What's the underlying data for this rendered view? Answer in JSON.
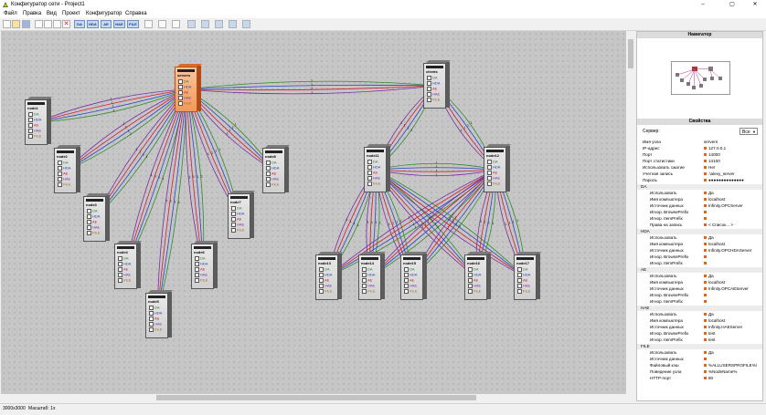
{
  "window": {
    "title": "Конфигуратор сети - Project1",
    "buttons": {
      "minimize": "–",
      "maximize": "▢",
      "close": "✕"
    }
  },
  "menu": [
    "Файл",
    "Правка",
    "Вид",
    "Проект",
    "Конфигуратор",
    "Справка"
  ],
  "toolbar": {
    "file_buttons": [
      "new-icon",
      "open-icon",
      "save-icon",
      "cut-icon",
      "copy-icon",
      "paste-icon",
      "delete-icon"
    ],
    "server_types": [
      "DA",
      "HDA",
      "AE",
      "HAE",
      "FILE"
    ],
    "view_buttons": [
      "window-icon",
      "layers-icon",
      "connect-icon",
      "align-left-icon",
      "align-top-icon",
      "arrange-icon",
      "tree-icon"
    ]
  },
  "nodes": [
    {
      "name": "servers",
      "selected": true,
      "items": [
        "DA",
        "HDA",
        "AE",
        "HAE",
        "FILE"
      ]
    },
    {
      "name": "clients",
      "selected": false,
      "items": [
        "DA",
        "HDA",
        "AE",
        "HAE",
        "FILE"
      ]
    },
    {
      "name": "node1",
      "selected": false,
      "items": [
        "DA",
        "HDA",
        "AE",
        "HAE",
        "FILE"
      ]
    },
    {
      "name": "node2",
      "selected": false,
      "items": [
        "DA",
        "HDA",
        "AE",
        "HAE",
        "FILE"
      ]
    },
    {
      "name": "node3",
      "selected": false,
      "items": [
        "DA",
        "HDA",
        "AE",
        "HAE",
        "FILE"
      ]
    },
    {
      "name": "node4",
      "selected": false,
      "items": [
        "DA",
        "HDA",
        "AE",
        "HAE",
        "FILE"
      ]
    },
    {
      "name": "node5",
      "selected": false,
      "items": [
        "DA",
        "HDA",
        "AE",
        "HAE",
        "FILE"
      ]
    },
    {
      "name": "node6",
      "selected": false,
      "items": [
        "DA",
        "HDA",
        "AE",
        "HAE",
        "FILE"
      ]
    },
    {
      "name": "node7",
      "selected": false,
      "items": [
        "DA",
        "HDA",
        "AE",
        "HAE",
        "FILE"
      ]
    },
    {
      "name": "node8",
      "selected": false,
      "items": [
        "DA",
        "HDA",
        "AE",
        "HAE",
        "FILE"
      ]
    },
    {
      "name": "node11",
      "selected": false,
      "items": [
        "DA",
        "HDA",
        "AE",
        "HAE",
        "FILE"
      ]
    },
    {
      "name": "node12",
      "selected": false,
      "items": [
        "DA",
        "HDA",
        "AE",
        "HAE",
        "FILE"
      ]
    },
    {
      "name": "node13",
      "selected": false,
      "items": [
        "DA",
        "HDA",
        "AE",
        "HAE",
        "FILE"
      ]
    },
    {
      "name": "node14",
      "selected": false,
      "items": [
        "DA",
        "HDA",
        "AE",
        "HAE",
        "FILE"
      ]
    },
    {
      "name": "node15",
      "selected": false,
      "items": [
        "DA",
        "HDA",
        "AE",
        "HAE",
        "FILE"
      ]
    },
    {
      "name": "node16",
      "selected": false,
      "items": [
        "DA",
        "HDA",
        "AE",
        "HAE",
        "FILE"
      ]
    },
    {
      "name": "node17",
      "selected": false,
      "items": [
        "DA",
        "HDA",
        "AE",
        "HAE",
        "FILE"
      ]
    }
  ],
  "connection_label": "1",
  "connection_colors": [
    "#2e8b2e",
    "#2a44c9",
    "#d01c2c",
    "#7a2aa8"
  ],
  "status": {
    "size": "3000x3000",
    "scale": "Масштаб: 1x"
  },
  "navigator": {
    "title": "Навигатор"
  },
  "properties": {
    "title": "Свойства",
    "server_label": "Сервер:",
    "server_filter": "Все",
    "rows": [
      {
        "key": "Имя узла",
        "value": "servers",
        "level": 1,
        "marker": false
      },
      {
        "key": "IP-адрес",
        "value": "127.0.0.1",
        "level": 1,
        "marker": true
      },
      {
        "key": "Порт",
        "value": "14000",
        "level": 1,
        "marker": true
      },
      {
        "key": "Порт статистики",
        "value": "14100",
        "level": 1,
        "marker": true
      },
      {
        "key": "Использовать сжатие",
        "value": "Нет",
        "level": 1,
        "marker": true
      },
      {
        "key": "Учетная запись",
        "value": ".\\alexy_server",
        "level": 1,
        "marker": true
      },
      {
        "key": "Пароль",
        "value": "●●●●●●●●●●●●●●",
        "level": 1,
        "marker": true
      },
      {
        "key": "DA",
        "value": "",
        "level": 0,
        "marker": false
      },
      {
        "key": "Использовать",
        "value": "Да",
        "level": 2,
        "marker": true
      },
      {
        "key": "Имя компьютера",
        "value": "localhost",
        "level": 2,
        "marker": true
      },
      {
        "key": "Источник данных",
        "value": "Infinity.OPCServer",
        "level": 2,
        "marker": true
      },
      {
        "key": "Игнор. BrowsePrefix",
        "value": "",
        "level": 2,
        "marker": true
      },
      {
        "key": "Игнор. ItemPrefix",
        "value": "",
        "level": 2,
        "marker": true
      },
      {
        "key": "Права на запись",
        "value": "< Список... >",
        "level": 2,
        "marker": true
      },
      {
        "key": "HDA",
        "value": "",
        "level": 0,
        "marker": false
      },
      {
        "key": "Использовать",
        "value": "Да",
        "level": 2,
        "marker": true
      },
      {
        "key": "Имя компьютера",
        "value": "localhost",
        "level": 2,
        "marker": true
      },
      {
        "key": "Источник данных",
        "value": "Infinity.OPCHDAServer",
        "level": 2,
        "marker": true
      },
      {
        "key": "Игнор. BrowsePrefix",
        "value": "",
        "level": 2,
        "marker": true
      },
      {
        "key": "Игнор. ItemPrefix",
        "value": "",
        "level": 2,
        "marker": true
      },
      {
        "key": "AE",
        "value": "",
        "level": 0,
        "marker": false
      },
      {
        "key": "Использовать",
        "value": "Да",
        "level": 2,
        "marker": true
      },
      {
        "key": "Имя компьютера",
        "value": "localhost",
        "level": 2,
        "marker": true
      },
      {
        "key": "Источник данных",
        "value": "Infinity.OPCAEServer",
        "level": 2,
        "marker": true
      },
      {
        "key": "Игнор. BrowsePrefix",
        "value": "",
        "level": 2,
        "marker": true
      },
      {
        "key": "Игнор. ItemPrefix",
        "value": "",
        "level": 2,
        "marker": true
      },
      {
        "key": "HAE",
        "value": "",
        "level": 0,
        "marker": false
      },
      {
        "key": "Использовать",
        "value": "Да",
        "level": 2,
        "marker": true
      },
      {
        "key": "Имя компьютера",
        "value": "localhost",
        "level": 2,
        "marker": true
      },
      {
        "key": "Источник данных",
        "value": "Infinity.HAEServer",
        "level": 2,
        "marker": true
      },
      {
        "key": "Игнор. BrowsePrefix",
        "value": "test",
        "level": 2,
        "marker": true
      },
      {
        "key": "Игнор. ItemPrefix",
        "value": "test",
        "level": 2,
        "marker": true
      },
      {
        "key": "FILE",
        "value": "",
        "level": 0,
        "marker": false
      },
      {
        "key": "Использовать",
        "value": "Да",
        "level": 2,
        "marker": true
      },
      {
        "key": "Источник данных",
        "value": "",
        "level": 2,
        "marker": true
      },
      {
        "key": "Файловый кэш",
        "value": "%ALLUSERSPROFILE%\\",
        "level": 2,
        "marker": true
      },
      {
        "key": "Поведение узла",
        "value": "%NodeName%",
        "level": 2,
        "marker": true
      },
      {
        "key": "HTTP-порт",
        "value": "80",
        "level": 2,
        "marker": true
      }
    ]
  }
}
